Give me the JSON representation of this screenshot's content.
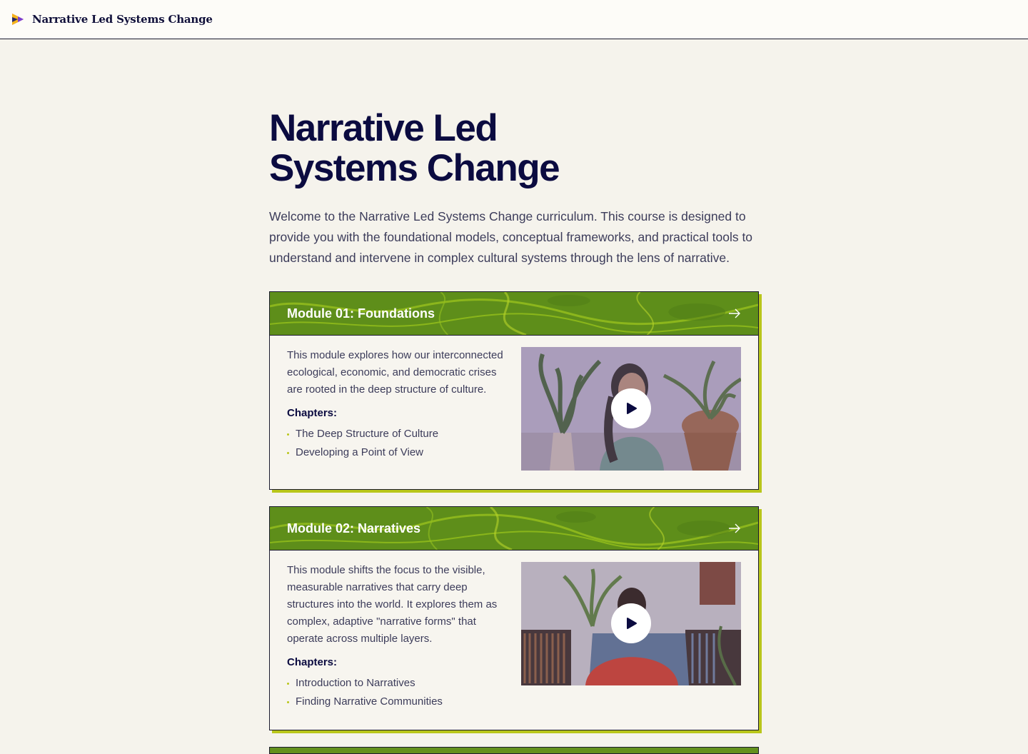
{
  "header": {
    "brand": "Narrative Led Systems Change",
    "logo_icon": "triangle-play-logo"
  },
  "hero": {
    "title_line1": "Narrative Led",
    "title_line2": "Systems Change",
    "intro": "Welcome to the Narrative Led Systems Change curriculum. This course is designed to provide you with the foundational models, conceptual frameworks, and practical tools to understand and intervene in complex cultural systems through the lens of narrative."
  },
  "modules": [
    {
      "title": "Module 01: Foundations",
      "description": "This module explores how our interconnected ecological, economic, and democratic crises are rooted in the deep structure of culture.",
      "chapters_label": "Chapters:",
      "chapters": [
        "The Deep Structure of Culture",
        "Developing a Point of View"
      ]
    },
    {
      "title": "Module 02: Narratives",
      "description": "This module shifts the focus to the visible, measurable narratives that carry deep structures into the world. It explores them as complex, adaptive \"narrative forms\" that operate across multiple layers.",
      "chapters_label": "Chapters:",
      "chapters": [
        "Introduction to Narratives",
        "Finding Narrative Communities"
      ]
    }
  ],
  "colors": {
    "accent": "#b9c61a",
    "header_green": "#63911c",
    "title_navy": "#0b0b40",
    "background": "#f5f3ec"
  }
}
